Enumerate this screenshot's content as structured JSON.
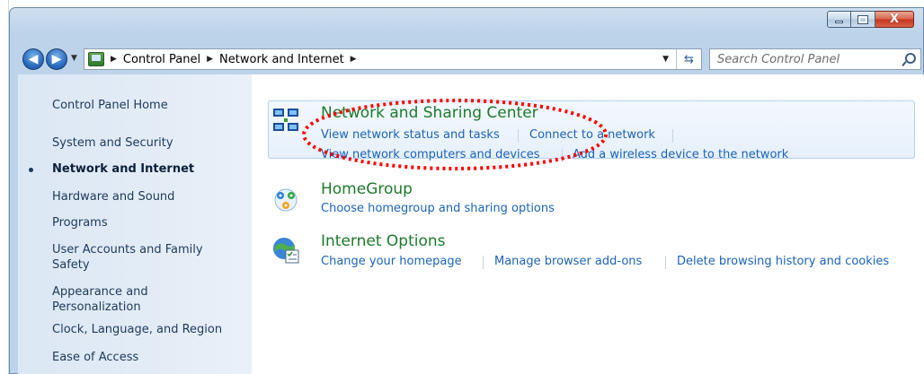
{
  "window": {
    "caption_buttons": {
      "minimize_icon": "minimize-icon",
      "maximize_icon": "maximize-icon",
      "close_glyph": "X"
    }
  },
  "address_bar": {
    "crumbs": [
      "Control Panel",
      "Network and Internet"
    ],
    "refresh_glyph": "⇆"
  },
  "search": {
    "placeholder": "Search Control Panel"
  },
  "left_pane": {
    "items": [
      {
        "label": "Control Panel Home",
        "active": false
      },
      {
        "label": "System and Security",
        "active": false
      },
      {
        "label": "Network and Internet",
        "active": true
      },
      {
        "label": "Hardware and Sound",
        "active": false
      },
      {
        "label": "Programs",
        "active": false
      },
      {
        "label": "User Accounts and Family Safety",
        "active": false
      },
      {
        "label": "Appearance and Personalization",
        "active": false
      },
      {
        "label": "Clock, Language, and Region",
        "active": false
      },
      {
        "label": "Ease of Access",
        "active": false
      }
    ]
  },
  "categories": [
    {
      "title": "Network and Sharing Center",
      "icon": "network-icon",
      "links": [
        "View network status and tasks",
        "Connect to a network",
        "View network computers and devices",
        "Add a wireless device to the network"
      ]
    },
    {
      "title": "HomeGroup",
      "icon": "homegroup-icon",
      "links": [
        "Choose homegroup and sharing options"
      ]
    },
    {
      "title": "Internet Options",
      "icon": "internet-options-icon",
      "links": [
        "Change your homepage",
        "Manage browser add-ons",
        "Delete browsing history and cookies"
      ]
    }
  ],
  "colors": {
    "link": "#1c63b7",
    "category_title": "#1d7a2c",
    "highlight_box_border": "#b7d2ef",
    "annotation": "#ff0000"
  }
}
